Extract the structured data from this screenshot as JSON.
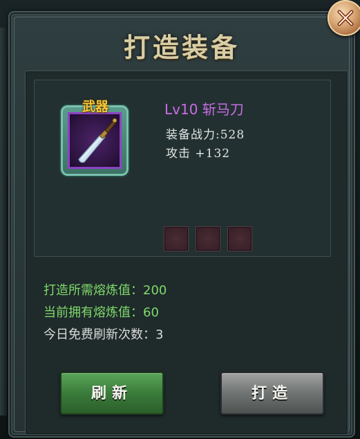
{
  "dialog": {
    "title": "打造装备",
    "close_icon": "close-icon"
  },
  "item": {
    "category_tag": "武器",
    "name": "Lv10 斩马刀",
    "power_label": "装备战力:528",
    "attack_label": "攻击 +132",
    "icon": "saber-weapon-icon",
    "rarity_color": "#8d43c4",
    "name_color": "#c86ee6",
    "gem_slots": [
      "empty",
      "empty",
      "empty"
    ]
  },
  "info": {
    "forge_cost": "打造所需熔炼值：200",
    "owned_smelt": "当前拥有熔炼值：60",
    "free_refresh": "今日免费刷新次数：3"
  },
  "buttons": {
    "refresh_label": "刷新",
    "forge_label": "打造"
  },
  "colors": {
    "green_text": "#7fdb6a",
    "title_gold": "#d9cda4",
    "refresh_button": "#3a7c3a",
    "forge_button": "#6f7372"
  }
}
